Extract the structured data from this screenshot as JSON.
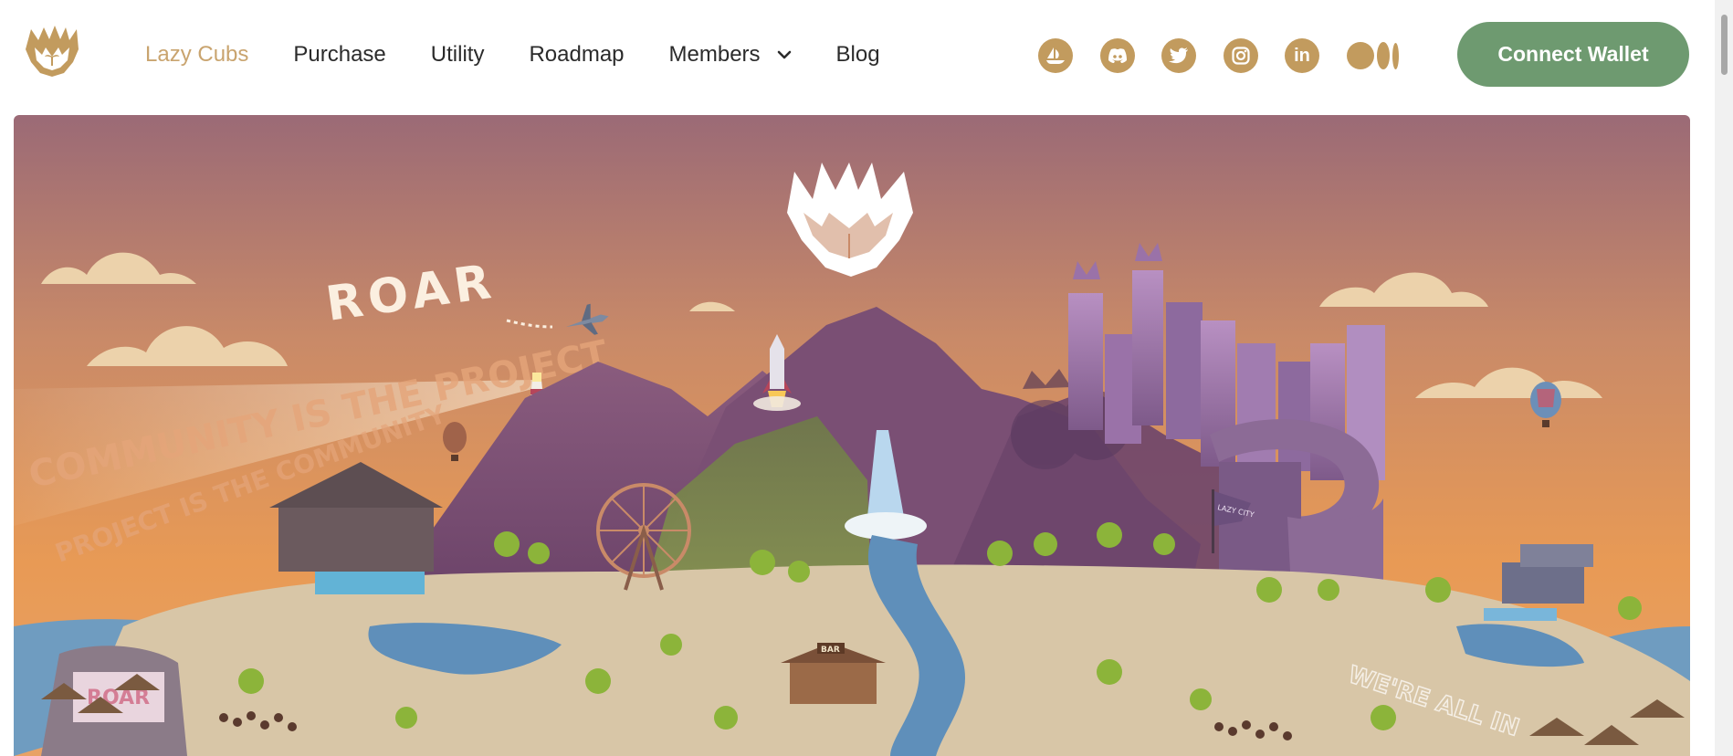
{
  "brand": {
    "logo_icon": "lion-claw-logo-icon",
    "primary_color": "#c29b5e",
    "accent_color": "#6e9a70"
  },
  "nav": {
    "items": [
      {
        "label": "Lazy Cubs",
        "active": true
      },
      {
        "label": "Purchase",
        "active": false
      },
      {
        "label": "Utility",
        "active": false
      },
      {
        "label": "Roadmap",
        "active": false
      },
      {
        "label": "Members",
        "active": false,
        "has_dropdown": true
      },
      {
        "label": "Blog",
        "active": false
      }
    ]
  },
  "socials": [
    {
      "name": "opensea",
      "icon": "opensea-boat-icon"
    },
    {
      "name": "discord",
      "icon": "discord-icon"
    },
    {
      "name": "twitter",
      "icon": "twitter-bird-icon"
    },
    {
      "name": "instagram",
      "icon": "instagram-icon"
    },
    {
      "name": "linkedin",
      "icon": "linkedin-icon",
      "glyph": "in"
    },
    {
      "name": "medium",
      "icon": "medium-icon"
    }
  ],
  "cta": {
    "connect_label": "Connect Wallet"
  },
  "hero": {
    "skywriting": "ROAR",
    "banner_line_1": "COMMUNITY IS THE PROJECT",
    "banner_line_2": "PROJECT IS THE COMMUNITY",
    "city_flag": "LAZY CITY",
    "bar_sign": "BAR",
    "stage_sign": "ROAR",
    "beach_writing": "WE'RE ALL IN",
    "sky_colors": [
      "#9b6a76",
      "#c98a68",
      "#e89a55"
    ]
  }
}
